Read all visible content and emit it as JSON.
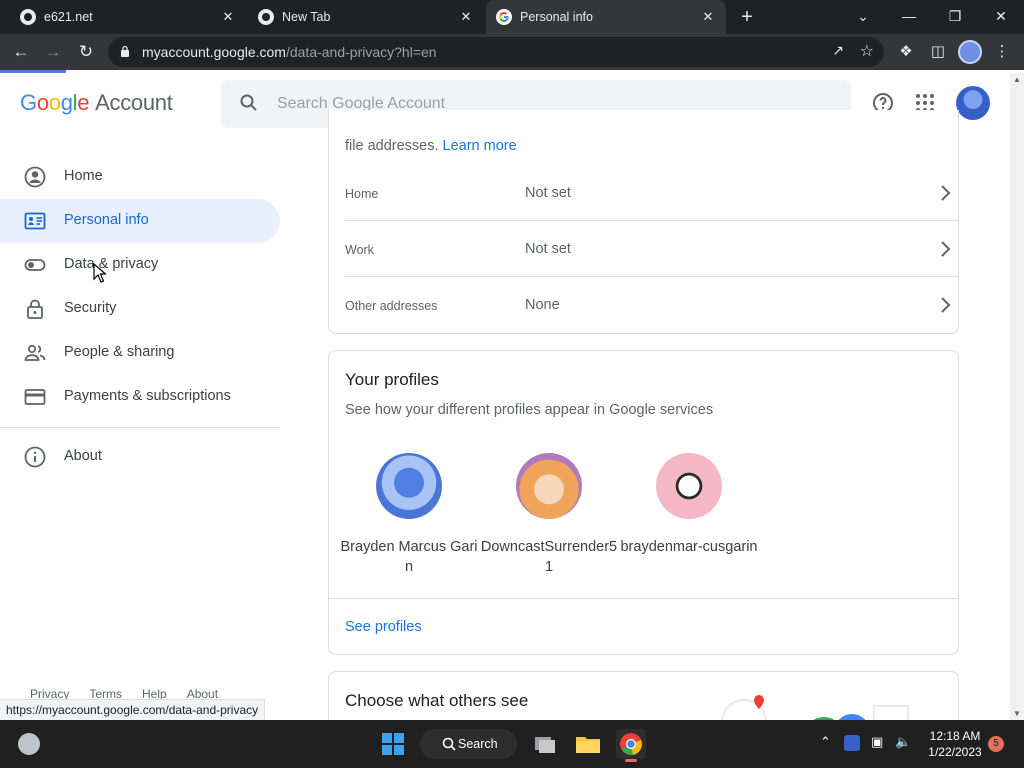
{
  "browser": {
    "tabs": [
      {
        "title": "e621.net",
        "close": "✕"
      },
      {
        "title": "New Tab",
        "close": "✕"
      },
      {
        "title": "Personal info",
        "close": "✕"
      }
    ],
    "new_tab": "+",
    "window_controls": {
      "dropdown": "⌄",
      "minimize": "—",
      "restore": "❐",
      "close": "✕"
    },
    "url_host": "myaccount.google.com",
    "url_path": "/data-and-privacy?hl=en",
    "status_url": "https://myaccount.google.com/data-and-privacy",
    "accent": "#4a79e8"
  },
  "header": {
    "logo": {
      "g1": "G",
      "o1": "o",
      "o2": "o",
      "g2": "g",
      "l": "l",
      "e": "e",
      "account": "Account"
    },
    "search_placeholder": "Search Google Account"
  },
  "sidebar": {
    "items": [
      {
        "label": "Home",
        "icon": "account-circle-icon"
      },
      {
        "label": "Personal info",
        "icon": "id-card-icon",
        "active": true
      },
      {
        "label": "Data & privacy",
        "icon": "toggle-icon"
      },
      {
        "label": "Security",
        "icon": "lock-icon"
      },
      {
        "label": "People & sharing",
        "icon": "people-icon"
      },
      {
        "label": "Payments & subscriptions",
        "icon": "credit-card-icon"
      },
      {
        "label": "About",
        "icon": "info-icon"
      }
    ],
    "footer": [
      "Privacy",
      "Terms",
      "Help",
      "About"
    ]
  },
  "addresses": {
    "note": "file addresses.",
    "learn_more": "Learn more",
    "rows": [
      {
        "label": "Home",
        "value": "Not set"
      },
      {
        "label": "Work",
        "value": "Not set"
      },
      {
        "label": "Other addresses",
        "value": "None"
      }
    ]
  },
  "profiles": {
    "title": "Your profiles",
    "subtitle": "See how your different profiles appear in Google services",
    "items": [
      {
        "name": "Brayden Marcus Garin",
        "color": "#5b86e0"
      },
      {
        "name": "DowncastSurrender51",
        "color": "#f0a45a"
      },
      {
        "name": "braydenmar-cusgarin",
        "color": "#f4b8c6"
      }
    ],
    "see_profiles": "See profiles"
  },
  "others": {
    "title": "Choose what others see"
  },
  "taskbar": {
    "search": "Search",
    "time": "12:18 AM",
    "date": "1/22/2023",
    "notifications": "5"
  }
}
